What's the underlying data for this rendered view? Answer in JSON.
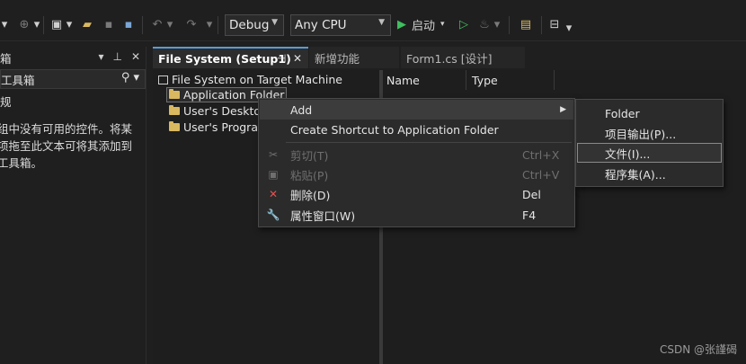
{
  "toolbar": {
    "config": "Debug",
    "platform": "Any CPU",
    "start_label": "启动"
  },
  "toolbox": {
    "title": "箱",
    "search_text": "工具箱",
    "group": "规",
    "message": "组中没有可用的控件。将某项拖至此文本可将其添加到工具箱。"
  },
  "tabs": [
    {
      "label": "File System (Setup1)",
      "active": true
    },
    {
      "label": "新增功能",
      "active": false
    },
    {
      "label": "Form1.cs [设计]",
      "active": false
    }
  ],
  "tree": {
    "root": "File System on Target Machine",
    "items": [
      "Application Folder",
      "User's Desktop",
      "User's Program"
    ]
  },
  "list": {
    "columns": [
      "Name",
      "Type"
    ]
  },
  "context_menu": {
    "items": [
      {
        "label": "Add",
        "shortcut": "",
        "icon": "none",
        "disabled": false,
        "submenu": true
      },
      {
        "label": "Create Shortcut to Application Folder",
        "shortcut": "",
        "icon": "none",
        "disabled": false
      },
      {
        "label": "剪切(T)",
        "shortcut": "Ctrl+X",
        "icon": "scissors-icon",
        "disabled": true
      },
      {
        "label": "粘贴(P)",
        "shortcut": "Ctrl+V",
        "icon": "paste-icon",
        "disabled": true
      },
      {
        "label": "删除(D)",
        "shortcut": "Del",
        "icon": "delete-x-icon",
        "disabled": false
      },
      {
        "label": "属性窗口(W)",
        "shortcut": "F4",
        "icon": "wrench-icon",
        "disabled": false
      }
    ]
  },
  "submenu": {
    "items": [
      "Folder",
      "项目输出(P)...",
      "文件(I)...",
      "程序集(A)..."
    ],
    "selected": "文件(I)..."
  },
  "watermark": "CSDN @张謹碣",
  "colors": {
    "background": "#1f1f1f",
    "accent": "#5b9bd5",
    "start_green": "#3fbf5f",
    "delete_red": "#e05252",
    "folder_yellow": "#d9b860"
  }
}
